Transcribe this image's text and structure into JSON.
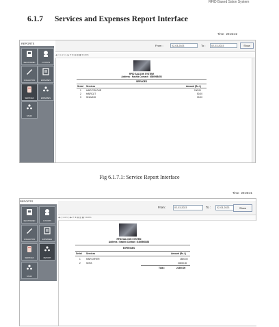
{
  "page_header": "RFID Based Salon System",
  "section": {
    "number": "6.1.7",
    "title": "Services and Expenses Report Interface"
  },
  "figure1": {
    "time_label": "Time:",
    "time": "20:22:22",
    "caption": "Fig 6.1.7.1: Service Report Interface",
    "reports_label": "REPORTS",
    "sidebar": [
      {
        "label": "REGISTERED",
        "icon": "register-icon"
      },
      {
        "label": "C POINTS",
        "icon": "points-icon"
      },
      {
        "label": "COLLECTION",
        "icon": "collection-icon"
      },
      {
        "label": "EXPENSES",
        "icon": "expenses-icon"
      },
      {
        "label": "SERVICES",
        "icon": "services-icon"
      },
      {
        "label": "EXPENSES",
        "icon": "users-icon"
      },
      {
        "label": "STAFF",
        "icon": "staff-icon"
      }
    ],
    "from_label": "From :",
    "from_value": "02-03-2023",
    "to_label": "To :",
    "to_value": "02-03-2023",
    "show_label": "Show",
    "toolbar": "◀ ◁  1  of 1 ▷ ▶  ⟳  ⊗  ▤  ▥  ▦ ▾  100%",
    "report": {
      "system": "RFID SALOON SYSTEM",
      "address": "Address : Nashik Contact : 8380968453",
      "heading": "SERVICES",
      "col_serial": "Serial",
      "col_name": "Services",
      "col_amount": "Amount (Rs./-)",
      "rows": [
        {
          "serial": "1",
          "name": "HAIR COLOUR",
          "amount": "100.00"
        },
        {
          "serial": "2",
          "name": "HAIRCUT",
          "amount": "50.00"
        },
        {
          "serial": "3",
          "name": "SHAVING",
          "amount": "30.00"
        }
      ]
    }
  },
  "figure2": {
    "time_label": "Time:",
    "time": "20:26:21",
    "reports_label": "REPORTS",
    "sidebar": [
      {
        "label": "REGISTERED",
        "icon": "register-icon"
      },
      {
        "label": "C POINTS",
        "icon": "points-icon"
      },
      {
        "label": "COLLECTION",
        "icon": "collection-icon"
      },
      {
        "label": "EXPENSES",
        "icon": "expenses-icon"
      },
      {
        "label": "SERVICES",
        "icon": "services-icon"
      },
      {
        "label": "REPORT",
        "icon": "users-icon"
      },
      {
        "label": "STAFF",
        "icon": "staff-icon"
      }
    ],
    "from_label": "From :",
    "from_value": "02-03-2023",
    "to_label": "To :",
    "to_value": "02-03-2023",
    "show_label": "Show",
    "toolbar": "◀ ◁  1  of 1 ▷ ▶  ⟳  ⊗  ▤  ▥  ▦ ▾  100%",
    "report": {
      "system": "RFID SALOON SYSTEM",
      "address": "Address : Nashik Contact : 8380968453",
      "heading": "EXPENSES",
      "col_serial": "Serial",
      "col_name": "Services",
      "col_amount": "Amount (Rs./-)",
      "rows": [
        {
          "serial": "1",
          "name": "HAIR DRYER",
          "amount": "1500.00"
        },
        {
          "serial": "2",
          "name": "SOFA",
          "amount": "20000.00"
        }
      ],
      "total_label": "Total :",
      "total": "21500.00"
    }
  },
  "colors": {
    "sidebar": "#7a8088",
    "tile": "#5d646c",
    "accent": "#8a9bb5"
  }
}
